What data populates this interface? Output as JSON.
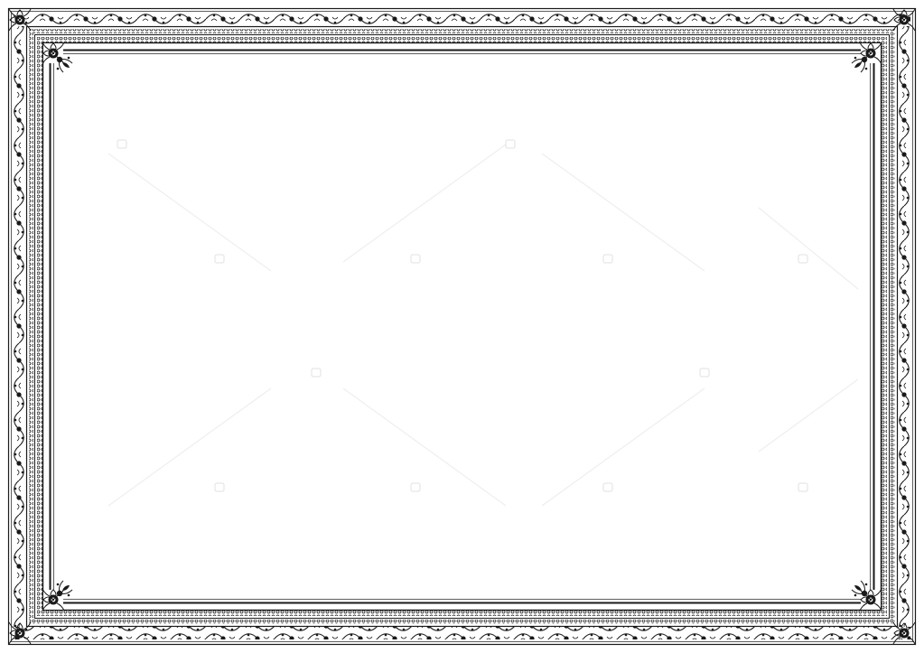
{
  "certificate_frame": {
    "style": "ornate-floral-border",
    "colors": {
      "ink": "#1a1a1a",
      "paper": "#ffffff",
      "watermark": "#e9e9e9"
    },
    "center_text": ""
  },
  "icons": {
    "corner_ornament": "floral-rosette-icon",
    "border_motif": "scroll-vine-icon",
    "watermark_mark": "camera-icon"
  }
}
